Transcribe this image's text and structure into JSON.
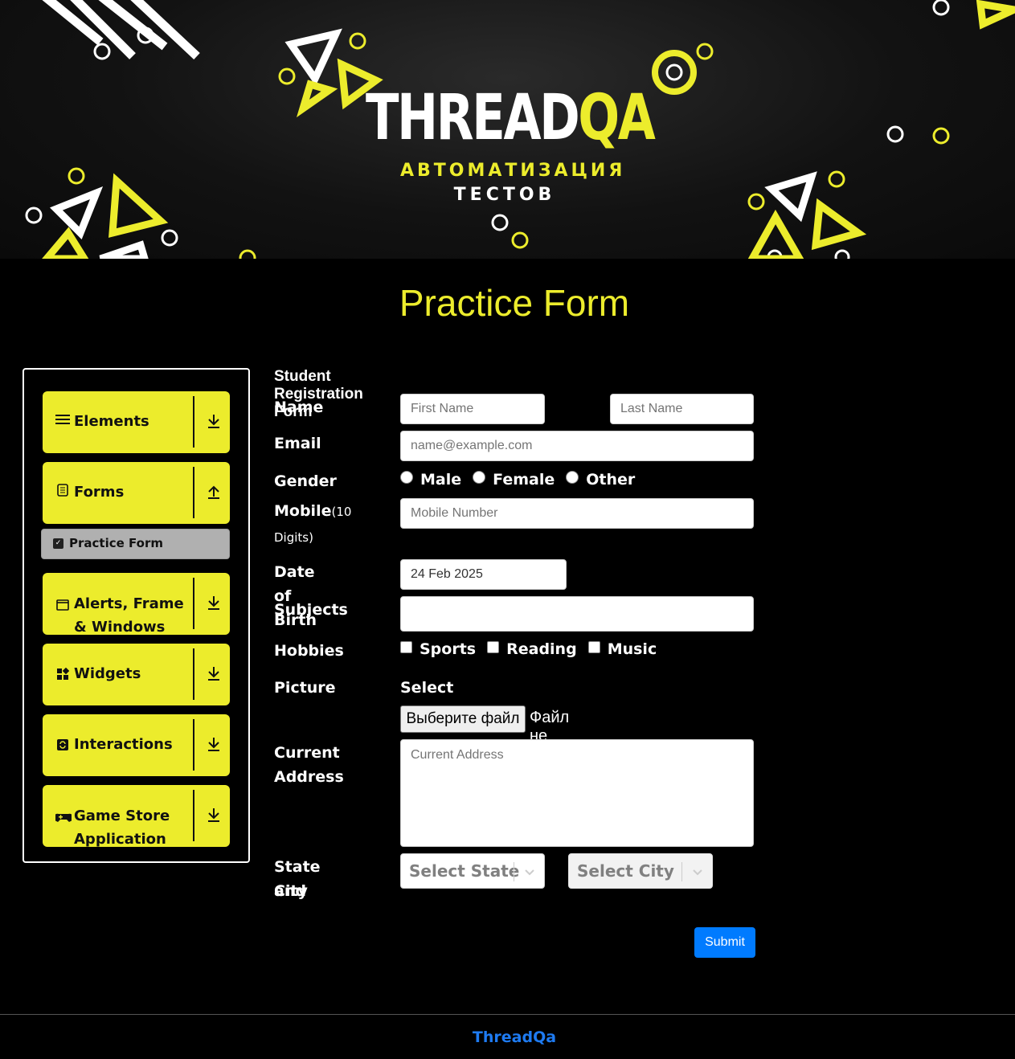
{
  "banner": {
    "logo_white": "THREAD",
    "logo_yellow": "QA",
    "tagline_1": "АВТОМАТИЗАЦИЯ",
    "tagline_2": "ТЕСТОВ"
  },
  "page_title": "Practice Form",
  "sidebar": {
    "groups": [
      {
        "label": "Elements",
        "icon": "hamburger-icon",
        "arrow": "download-arrow-icon"
      },
      {
        "label": "Forms",
        "icon": "document-icon",
        "arrow": "upload-arrow-icon"
      },
      {
        "label": "Alerts, Frame & Windows",
        "icon": "window-icon",
        "arrow": "download-arrow-icon"
      },
      {
        "label": "Widgets",
        "icon": "widgets-icon",
        "arrow": "download-arrow-icon"
      },
      {
        "label": "Interactions",
        "icon": "interactions-icon",
        "arrow": "download-arrow-icon"
      },
      {
        "label": "Game Store Application",
        "icon": "gamepad-icon",
        "arrow": "download-arrow-icon"
      }
    ],
    "active_item": {
      "label": "Practice Form",
      "icon": "checkbox-icon"
    }
  },
  "form": {
    "heading": "Student Registration Form",
    "name_label": "Name",
    "first_name_placeholder": "First Name",
    "last_name_placeholder": "Last Name",
    "email_label": "Email",
    "email_placeholder": "name@example.com",
    "gender_label": "Gender",
    "gender_options": [
      "Male",
      "Female",
      "Other"
    ],
    "mobile_label": "Mobile",
    "mobile_hint": "(10",
    "mobile_hint_2": "Digits)",
    "mobile_placeholder": "Mobile Number",
    "dob_label": "Date of Birth",
    "dob_value": "24 Feb 2025",
    "subjects_label": "Subjects",
    "hobbies_label": "Hobbies",
    "hobby_options": [
      "Sports",
      "Reading",
      "Music"
    ],
    "picture_label": "Picture",
    "select_picture_label": "Select picture",
    "file_button": "Выберите файл",
    "file_status": "Файл не выбран",
    "address_label_1": "Current",
    "address_label_2": "Address",
    "address_placeholder": "Current Address",
    "state_city_label_1": "State and",
    "state_city_label_2": "City",
    "state_placeholder": "Select State",
    "city_placeholder": "Select City",
    "submit_label": "Submit"
  },
  "footer": {
    "text": "ThreadQa"
  },
  "colors": {
    "accent": "#ecec2c",
    "submit": "#007bff",
    "footer_link": "#1e7bf2"
  }
}
